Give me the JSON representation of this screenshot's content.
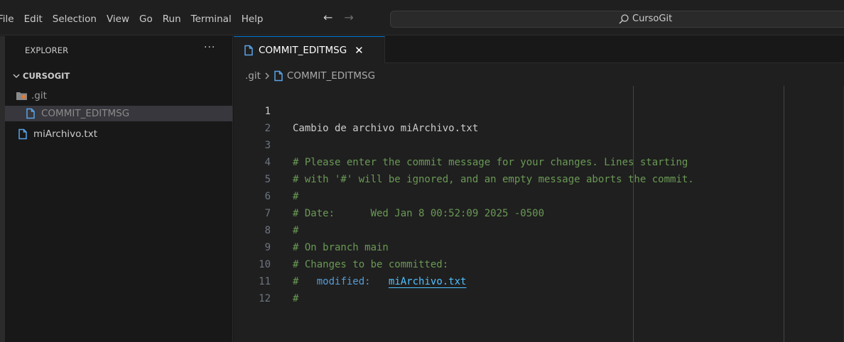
{
  "menu": {
    "items": [
      "File",
      "Edit",
      "Selection",
      "View",
      "Go",
      "Run",
      "Terminal",
      "Help"
    ]
  },
  "command_center": {
    "label": "CursoGit"
  },
  "sidebar": {
    "title": "EXPLORER",
    "more": "···",
    "root": "CURSOGIT",
    "items": [
      {
        "label": ".git"
      },
      {
        "label": "COMMIT_EDITMSG"
      },
      {
        "label": "miArchivo.txt"
      }
    ]
  },
  "editor": {
    "tab": {
      "label": "COMMIT_EDITMSG",
      "close": "✕"
    },
    "breadcrumb": {
      "folder": ".git",
      "file": "COMMIT_EDITMSG"
    },
    "lines": [
      {
        "n": "1",
        "text": "Cambio de archivo miArchivo.txt"
      },
      {
        "n": "2",
        "text": ""
      },
      {
        "n": "3",
        "text": "# Please enter the commit message for your changes. Lines starting"
      },
      {
        "n": "4",
        "text": "# with '#' will be ignored, and an empty message aborts the commit."
      },
      {
        "n": "5",
        "text": "#"
      },
      {
        "n": "6",
        "text": "# Date:      Wed Jan 8 00:52:09 2025 -0500"
      },
      {
        "n": "7",
        "text": "#"
      },
      {
        "n": "8",
        "text": "# On branch main"
      },
      {
        "n": "9",
        "text": "# Changes to be committed:"
      },
      {
        "n": "10",
        "hash": "#",
        "keyword": "modified:",
        "file": "miArchivo.txt"
      },
      {
        "n": "11",
        "text": "#"
      },
      {
        "n": "12",
        "text": ""
      }
    ]
  },
  "colors": {
    "accent": "#0078d4",
    "comment": "#6a9955",
    "keyword": "#569cd6",
    "link": "#4fc1ff",
    "git_folder": "#e37933"
  }
}
